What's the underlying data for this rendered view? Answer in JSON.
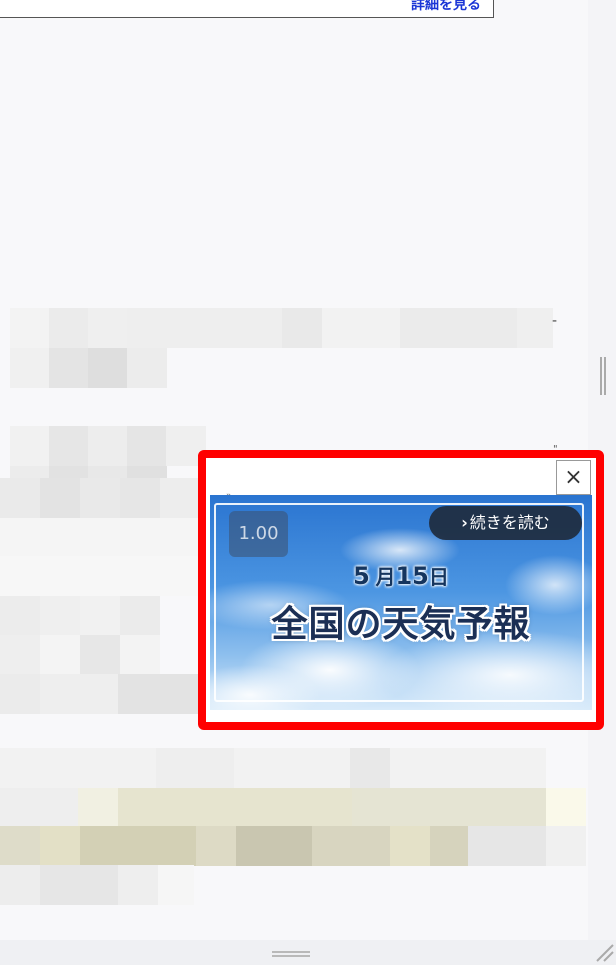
{
  "top_link": {
    "label": "詳細を見る"
  },
  "ad": {
    "close_symbol": "×",
    "speed_label": "1.00",
    "read_more_label": "続きを読む",
    "date": {
      "month": "5",
      "month_unit": "月",
      "day": "15",
      "day_unit": "日"
    },
    "title": "全国の天気予報"
  },
  "colors": {
    "highlight_border": "#ff0000",
    "link": "#1a35d6"
  }
}
